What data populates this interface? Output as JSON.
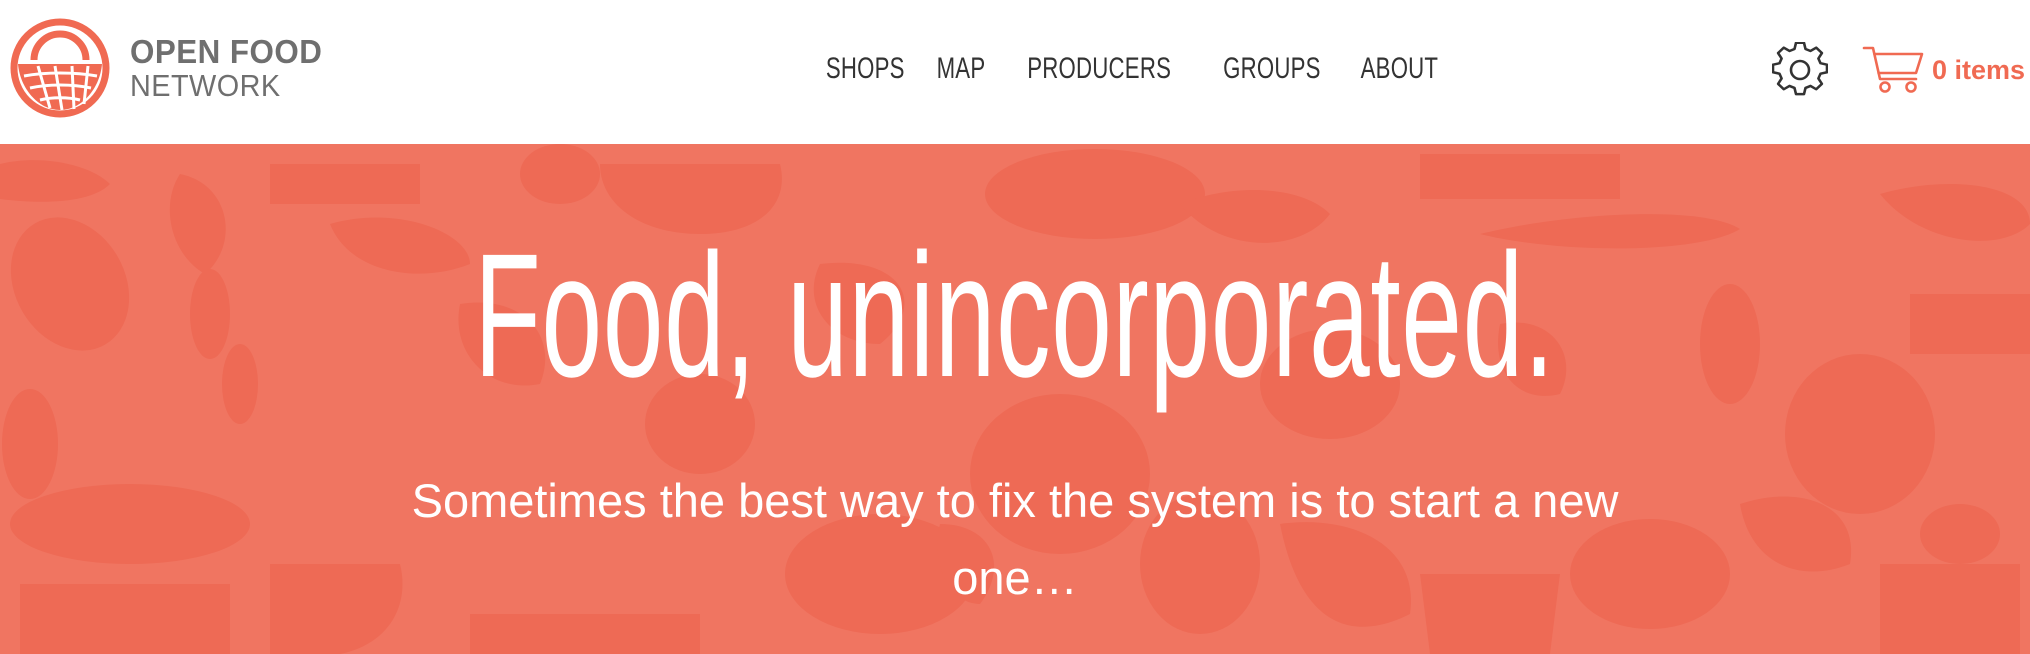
{
  "brand": {
    "line1": "OPEN FOOD",
    "line2": "NETWORK",
    "accent_color": "#f06a52",
    "text_color": "#6f6f6f"
  },
  "nav": {
    "items": [
      {
        "label": "SHOPS"
      },
      {
        "label": "MAP"
      },
      {
        "label": "PRODUCERS"
      },
      {
        "label": "GROUPS"
      },
      {
        "label": "ABOUT"
      }
    ]
  },
  "header_actions": {
    "settings_icon": "gear-icon",
    "cart_icon": "cart-icon",
    "cart_label": "0 items"
  },
  "hero": {
    "title": "Food, unincorporated.",
    "subtitle": "Sometimes the best way to fix the system is to start a new one…",
    "background_color": "#f07561",
    "pattern_color": "#ee6a55",
    "text_color": "#ffffff"
  }
}
